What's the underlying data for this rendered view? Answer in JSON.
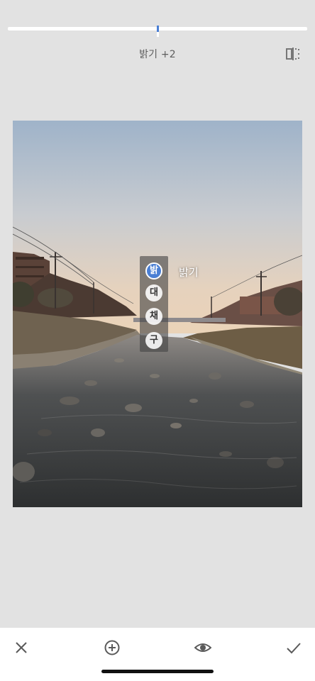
{
  "adjustment": {
    "label": "밝기 +2",
    "value": 2
  },
  "tool_menu": {
    "items": [
      {
        "glyph": "밝",
        "active": true
      },
      {
        "glyph": "대",
        "active": false
      },
      {
        "glyph": "채",
        "active": false
      },
      {
        "glyph": "구",
        "active": false
      }
    ],
    "active_caption": "밝기"
  },
  "icons": {
    "compare": "compare-icon",
    "cancel": "close-icon",
    "add": "plus-circle-icon",
    "preview": "eye-icon",
    "apply": "checkmark-icon"
  },
  "colors": {
    "accent": "#4a7fd4",
    "background": "#e2e2e2"
  }
}
